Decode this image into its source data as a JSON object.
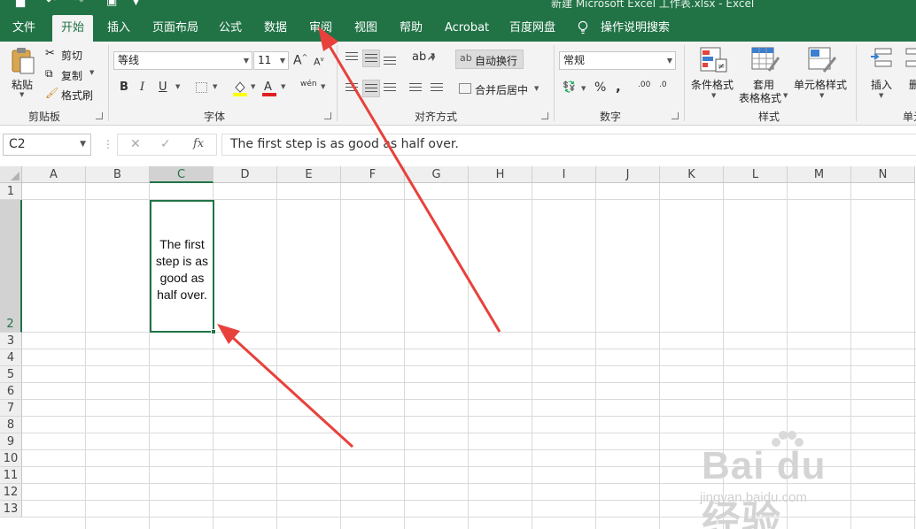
{
  "window": {
    "title": "新建 Microsoft Excel 工作表.xlsx - Excel"
  },
  "tabs": [
    {
      "label": "文件"
    },
    {
      "label": "开始",
      "active": true
    },
    {
      "label": "插入"
    },
    {
      "label": "页面布局"
    },
    {
      "label": "公式"
    },
    {
      "label": "数据"
    },
    {
      "label": "审阅"
    },
    {
      "label": "视图"
    },
    {
      "label": "帮助"
    },
    {
      "label": "Acrobat"
    },
    {
      "label": "百度网盘"
    }
  ],
  "tell_me": {
    "label": "操作说明搜索",
    "icon": "lightbulb-icon"
  },
  "clipboard": {
    "paste": "粘贴",
    "cut": "剪切",
    "copy": "复制",
    "format_painter": "格式刷",
    "group": "剪贴板"
  },
  "font": {
    "name": "等线",
    "size": "11",
    "bold": "B",
    "italic": "I",
    "underline": "U",
    "group": "字体",
    "phonetic": "wén",
    "grow": "A",
    "shrink": "A"
  },
  "alignment": {
    "wrap": "自动换行",
    "merge": "合并后居中",
    "group": "对齐方式"
  },
  "number": {
    "format": "常规",
    "percent": "%",
    "comma": ",",
    "group": "数字",
    "inc_decimal": ".00",
    "dec_decimal": ".0"
  },
  "styles": {
    "conditional": "条件格式",
    "table_line1": "套用",
    "table_line2": "表格格式",
    "cell_styles": "单元格样式",
    "group": "样式"
  },
  "cells": {
    "insert": "插入",
    "delete": "删",
    "group": "单元"
  },
  "formula_bar": {
    "name_box": "C2",
    "fx": "fx",
    "content": "The first step is as good as half over."
  },
  "sheet": {
    "columns": [
      "A",
      "B",
      "C",
      "D",
      "E",
      "F",
      "G",
      "H",
      "I",
      "J",
      "K",
      "L",
      "M",
      "N"
    ],
    "rows": [
      "1",
      "2",
      "3",
      "4",
      "5",
      "6",
      "7",
      "8",
      "9",
      "10",
      "11",
      "12",
      "13"
    ],
    "selected_column": "C",
    "selected_row": "2",
    "cell_c2_lines": [
      "The first",
      "step is as",
      "good as",
      "half over."
    ]
  },
  "watermark": {
    "brand": "Bai du 经验",
    "url": "jingyan.baidu.com"
  },
  "colors": {
    "excel_green": "#217346",
    "annotation_arrow": "#e8413c"
  }
}
